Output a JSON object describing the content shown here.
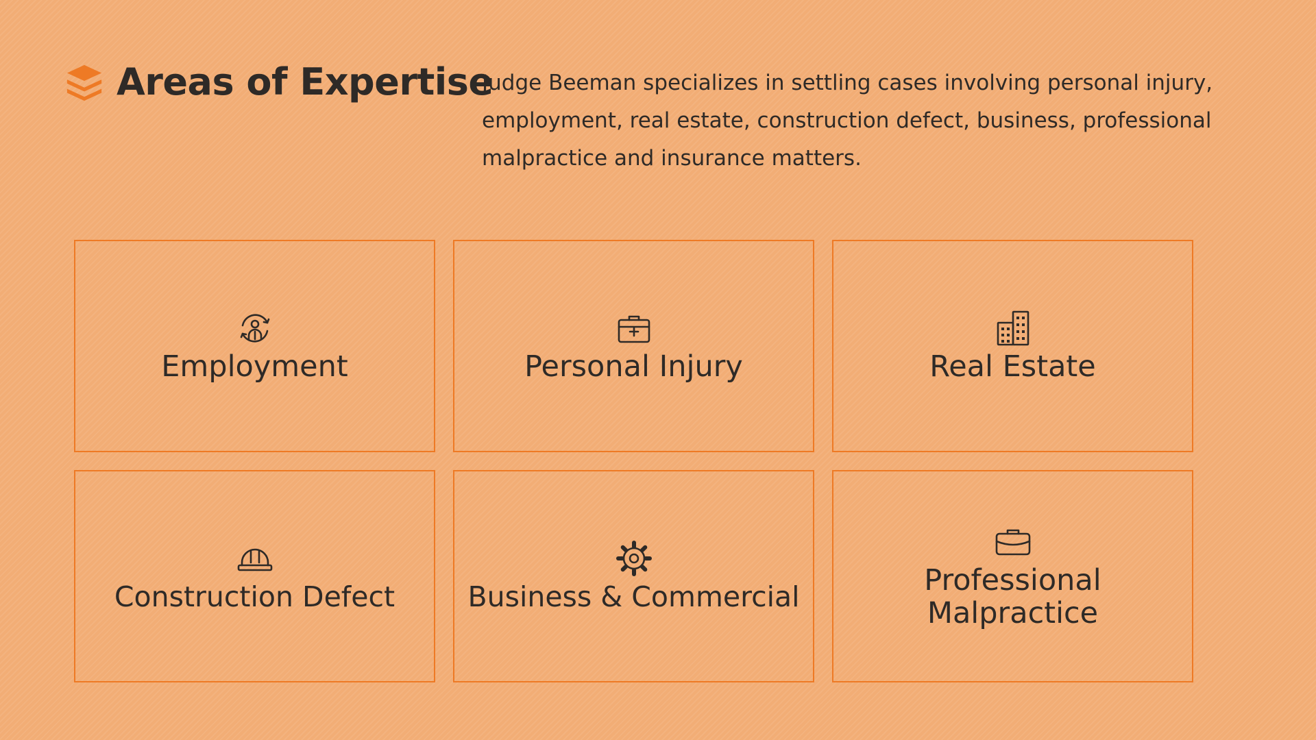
{
  "header": {
    "title": "Areas of Expertise",
    "icon": "layers-icon",
    "accent_color": "#ee7a25"
  },
  "intro": {
    "text": "Judge Beeman specializes in settling cases involving personal injury, employment, real estate, construction defect, business, professional malpractice and insurance matters."
  },
  "areas": [
    {
      "label": "Employment",
      "icon": "employee-cycle-icon"
    },
    {
      "label": "Personal Injury",
      "icon": "medical-kit-icon"
    },
    {
      "label": "Real Estate",
      "icon": "buildings-icon"
    },
    {
      "label": "Construction Defect",
      "icon": "hard-hat-icon"
    },
    {
      "label": "Business & Commercial",
      "icon": "gear-icon"
    },
    {
      "label": "Professional Malpractice",
      "icon": "briefcase-icon"
    }
  ],
  "colors": {
    "background": "#f2ad75",
    "border": "#ee7a25",
    "text": "#2e2a27"
  }
}
